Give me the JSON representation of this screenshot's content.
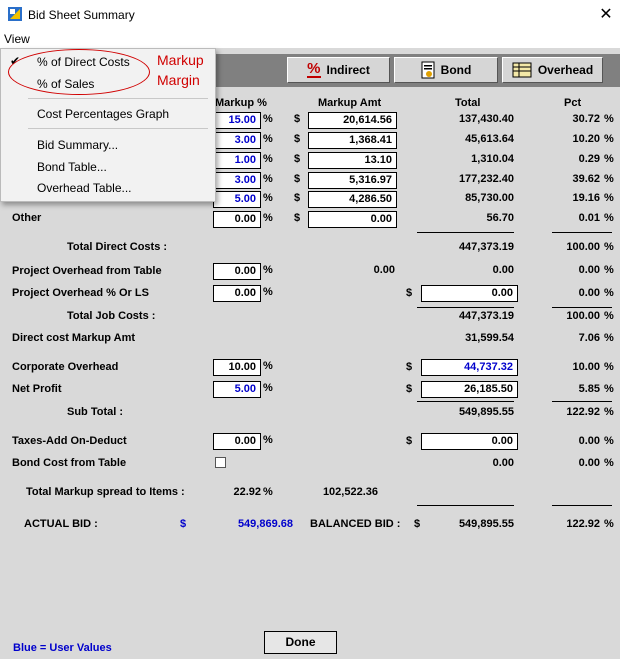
{
  "window": {
    "title": "Bid Sheet Summary",
    "close": "✕"
  },
  "menubar": {
    "view": "View"
  },
  "view_menu": {
    "check": "✔",
    "items": [
      "% of Direct Costs",
      "% of Sales",
      "Cost Percentages Graph",
      "Bid Summary...",
      "Bond Table...",
      "Overhead Table..."
    ]
  },
  "annotation": {
    "markup": "Markup",
    "margin": "Margin"
  },
  "toolbar": {
    "indirect": "Indirect",
    "bond": "Bond",
    "overhead": "Overhead",
    "indirect_icon": "%"
  },
  "headers": {
    "markup_pct": "Markup %",
    "markup_amt": "Markup Amt",
    "total": "Total",
    "pct": "Pct"
  },
  "cost_rows": [
    {
      "label": "",
      "markup": "15.00",
      "amt": "20,614.56",
      "total": "137,430.40",
      "pct": "30.72"
    },
    {
      "label": "",
      "markup": "3.00",
      "amt": "1,368.41",
      "total": "45,613.64",
      "pct": "10.20"
    },
    {
      "label": "",
      "markup": "1.00",
      "amt": "13.10",
      "total": "1,310.04",
      "pct": "0.29"
    },
    {
      "label": "",
      "markup": "3.00",
      "amt": "5,316.97",
      "total": "177,232.40",
      "pct": "39.62"
    },
    {
      "label": "",
      "markup": "5.00",
      "amt": "4,286.50",
      "total": "85,730.00",
      "pct": "19.16"
    },
    {
      "label": "Other",
      "markup": "0.00",
      "amt": "0.00",
      "total": "56.70",
      "pct": "0.01"
    }
  ],
  "symbols": {
    "pct": "%",
    "dollar": "$"
  },
  "summary": {
    "total_direct_label": "Total Direct Costs :",
    "total_direct": "447,373.19",
    "total_direct_pct": "100.00",
    "poh_table_label": "Project Overhead from Table",
    "poh_table_markup": "0.00",
    "poh_table_amt": "0.00",
    "poh_table_total": "0.00",
    "poh_table_pct": "0.00",
    "poh_ls_label": "Project Overhead % Or LS",
    "poh_ls_markup": "0.00",
    "poh_ls_total": "0.00",
    "poh_ls_pct": "0.00",
    "total_job_label": "Total Job Costs :",
    "total_job": "447,373.19",
    "total_job_pct": "100.00",
    "dc_markup_label": "Direct cost Markup Amt",
    "dc_markup": "31,599.54",
    "dc_markup_pct": "7.06",
    "corp_label": "Corporate Overhead",
    "corp_markup": "10.00",
    "corp_total": "44,737.32",
    "corp_pct": "10.00",
    "profit_label": "Net Profit",
    "profit_markup": "5.00",
    "profit_total": "26,185.50",
    "profit_pct": "5.85",
    "subtotal_label": "Sub Total :",
    "subtotal": "549,895.55",
    "subtotal_pct": "122.92",
    "taxes_label": "Taxes-Add On-Deduct",
    "taxes_markup": "0.00",
    "taxes_total": "0.00",
    "taxes_pct": "0.00",
    "bond_label": "Bond Cost from Table",
    "bond_total": "0.00",
    "bond_pct": "0.00",
    "spread_label": "Total Markup spread to Items :",
    "spread_pct": "22.92",
    "spread_amt": "102,522.36",
    "actual_label": "ACTUAL BID :",
    "actual_dollar": "$",
    "actual_value": "549,869.68",
    "balanced_label": "BALANCED BID :",
    "balanced_dollar": "$",
    "balanced_value": "549,895.55",
    "balanced_pct": "122.92"
  },
  "footer": {
    "legend": "Blue = User Values",
    "done": "Done"
  }
}
